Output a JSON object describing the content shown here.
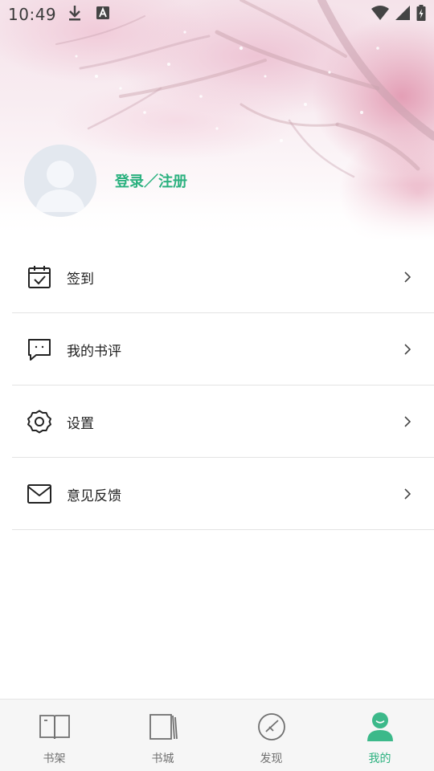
{
  "status_bar": {
    "time": "10:49",
    "left_icons": [
      "download-icon",
      "font-a-icon"
    ],
    "right_icons": [
      "wifi-icon",
      "cell-signal-icon",
      "battery-charging-icon"
    ]
  },
  "profile": {
    "login_label": "登录／注册",
    "avatar_icon": "default-avatar-icon"
  },
  "menu": {
    "items": [
      {
        "label": "签到",
        "icon": "calendar-check-icon"
      },
      {
        "label": "我的书评",
        "icon": "chat-bubble-icon"
      },
      {
        "label": "设置",
        "icon": "gear-icon"
      },
      {
        "label": "意见反馈",
        "icon": "envelope-icon"
      }
    ]
  },
  "bottom_nav": {
    "items": [
      {
        "label": "书架",
        "icon": "open-book-icon",
        "active": false
      },
      {
        "label": "书城",
        "icon": "book-store-icon",
        "active": false
      },
      {
        "label": "发现",
        "icon": "compass-icon",
        "active": false
      },
      {
        "label": "我的",
        "icon": "person-icon",
        "active": true
      }
    ],
    "active_color": "#2bb17f",
    "inactive_color": "#707070"
  },
  "colors": {
    "accent": "#2bb17f",
    "divider": "#e3e3e3",
    "nav_background": "#f6f6f6"
  }
}
